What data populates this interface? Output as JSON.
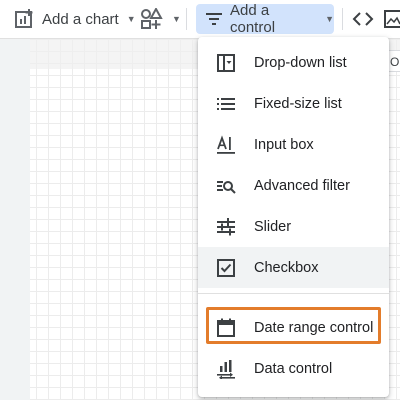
{
  "toolbar": {
    "add_chart_label": "Add a chart",
    "add_control_label": "Add a control",
    "icons": [
      "add-chart-icon",
      "community-components-icon",
      "filter-lines-icon",
      "code-embed-icon",
      "image-icon"
    ]
  },
  "canvas": {
    "right_tab_text": "O"
  },
  "menu": {
    "items": [
      {
        "label": "Drop-down list",
        "icon": "dropdown-list-icon"
      },
      {
        "label": "Fixed-size list",
        "icon": "fixed-size-list-icon"
      },
      {
        "label": "Input box",
        "icon": "input-box-icon"
      },
      {
        "label": "Advanced filter",
        "icon": "advanced-filter-icon"
      },
      {
        "label": "Slider",
        "icon": "slider-icon"
      },
      {
        "label": "Checkbox",
        "icon": "checkbox-icon"
      },
      {
        "label": "Date range control",
        "icon": "calendar-icon"
      },
      {
        "label": "Data control",
        "icon": "data-control-icon"
      }
    ]
  },
  "colors": {
    "highlight": "#e37c2b",
    "active_button": "#d2e3fc"
  }
}
